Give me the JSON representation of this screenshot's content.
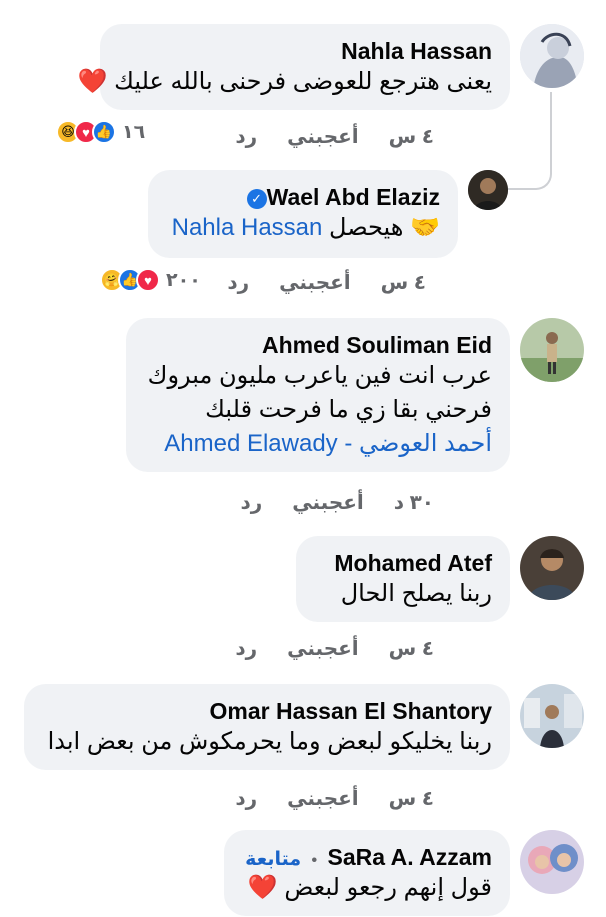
{
  "comments": [
    {
      "author": "Nahla Hassan",
      "text": "يعنى هترجع للعوضى فرحنى بالله عليك",
      "time": "٤ س",
      "like": "أعجبني",
      "reply": "رد",
      "reaction_count": "١٦"
    },
    {
      "author": "Wael Abd Elaziz",
      "text": "هيحصل",
      "mention": "Nahla Hassan",
      "time": "٤ س",
      "like": "أعجبني",
      "reply": "رد",
      "reaction_count": "٢٠٠"
    },
    {
      "author": "Ahmed Souliman Eid",
      "line1": "عرب انت فين ياعرب مليون مبروك",
      "line2": "فرحني بقا زي ما فرحت قلبك",
      "mention_ar": "أحمد العوضي",
      "mention_sep": " - ",
      "mention_en": "Ahmed Elawady",
      "time": "٣٠ د",
      "like": "أعجبني",
      "reply": "رد"
    },
    {
      "author": "Mohamed Atef",
      "text": "ربنا يصلح الحال",
      "time": "٤ س",
      "like": "أعجبني",
      "reply": "رد"
    },
    {
      "author": "Omar Hassan El Shantory",
      "text": "ربنا يخليكو لبعض وما يحرمكوش من بعض ابدا",
      "time": "٤ س",
      "like": "أعجبني",
      "reply": "رد"
    },
    {
      "author": "SaRa A. Azzam",
      "follow": "متابعة",
      "separator": "•",
      "text": "قول إنهم رجعو لبعض"
    }
  ],
  "colors": {
    "bubble": "#f0f2f5",
    "link": "#1a64c8",
    "meta": "#65676b",
    "like": "#1b74e4",
    "love": "#f02849"
  }
}
